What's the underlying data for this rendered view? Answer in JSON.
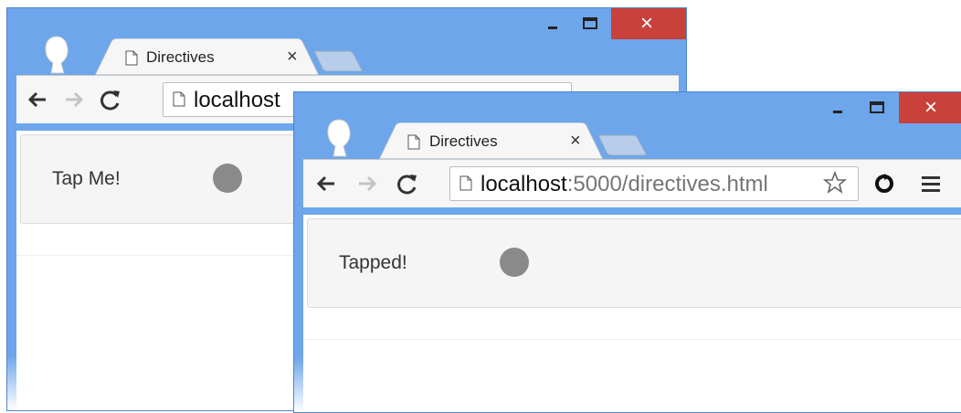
{
  "windows": [
    {
      "tab_title": "Directives",
      "tab_close": "×",
      "url_host": "localhost",
      "url_rest": "",
      "panel_text": "Tap Me!"
    },
    {
      "tab_title": "Directives",
      "tab_close": "×",
      "url_host": "localhost",
      "url_rest": ":5000/directives.html",
      "panel_text": "Tapped!"
    }
  ],
  "window_controls": {
    "close_symbol": "×"
  },
  "colors": {
    "titlebar": "#6da6ea",
    "close_button": "#c9413b",
    "toolbar": "#f6f6f6",
    "panel": "#f5f5f5",
    "circle": "#8a8a8a"
  },
  "icons": [
    "avatar-icon",
    "page-icon",
    "back-arrow-icon",
    "forward-arrow-icon",
    "reload-icon",
    "star-icon",
    "extension-icon",
    "menu-icon"
  ]
}
